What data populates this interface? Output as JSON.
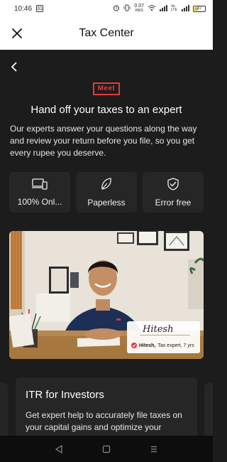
{
  "status_bar": {
    "time": "10:46",
    "notification_badge": "31",
    "net_speed": "0.07",
    "net_unit": "KB/S",
    "network_type": "Vo LTE",
    "battery_level": "37",
    "battery_percent": 37
  },
  "header": {
    "title": "Tax Center",
    "close_icon": "close-icon"
  },
  "hero": {
    "logo_text": "Meet",
    "headline": "Hand off your taxes to an expert",
    "description": "Our experts answer your questions along the way and review your return before you file, so you get every rupee you deserve."
  },
  "features": [
    {
      "icon": "devices-icon",
      "label": "100% Onl..."
    },
    {
      "icon": "leaf-icon",
      "label": "Paperless"
    },
    {
      "icon": "shield-check-icon",
      "label": "Error free"
    }
  ],
  "expert": {
    "signature": "Hitesh",
    "caption_name": "Hitesh,",
    "caption_role": "Tax expert, 7 yrs"
  },
  "plan_card": {
    "title": "ITR for Investors",
    "description": "Get expert help to accurately file taxes on your capital gains and optimize your"
  },
  "colors": {
    "accent": "#e23b3b",
    "background": "#1c1c1c",
    "card": "#262626",
    "header": "#ffffff"
  },
  "nav_bar": {
    "back": "nav-back-icon",
    "home": "nav-home-icon",
    "recents": "nav-recents-icon"
  }
}
